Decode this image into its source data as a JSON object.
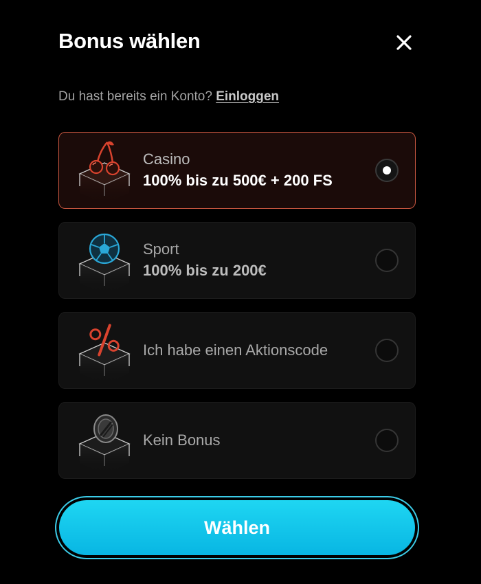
{
  "header": {
    "title": "Bonus wählen",
    "close_icon": "close-icon"
  },
  "login": {
    "prompt": "Du hast bereits ein Konto?",
    "link_label": "Einloggen"
  },
  "options": [
    {
      "label": "Casino",
      "sub": "100% bis zu 500€ + 200 FS",
      "icon": "cherries-icon",
      "selected": true
    },
    {
      "label": "Sport",
      "sub": "100% bis zu 200€",
      "icon": "football-icon",
      "selected": false
    },
    {
      "label": "Ich habe einen Aktionscode",
      "sub": "",
      "icon": "percent-icon",
      "selected": false
    },
    {
      "label": "Kein Bonus",
      "sub": "",
      "icon": "no-bonus-coin-icon",
      "selected": false
    }
  ],
  "submit": {
    "label": "Wählen"
  },
  "colors": {
    "background": "#000000",
    "card": "#111111",
    "selected_border": "#c6553f",
    "selected_bg": "#1b0b09",
    "accent_cyan": "#08b6e3",
    "icon_red": "#d9432e",
    "icon_blue": "#2aa8d8"
  }
}
